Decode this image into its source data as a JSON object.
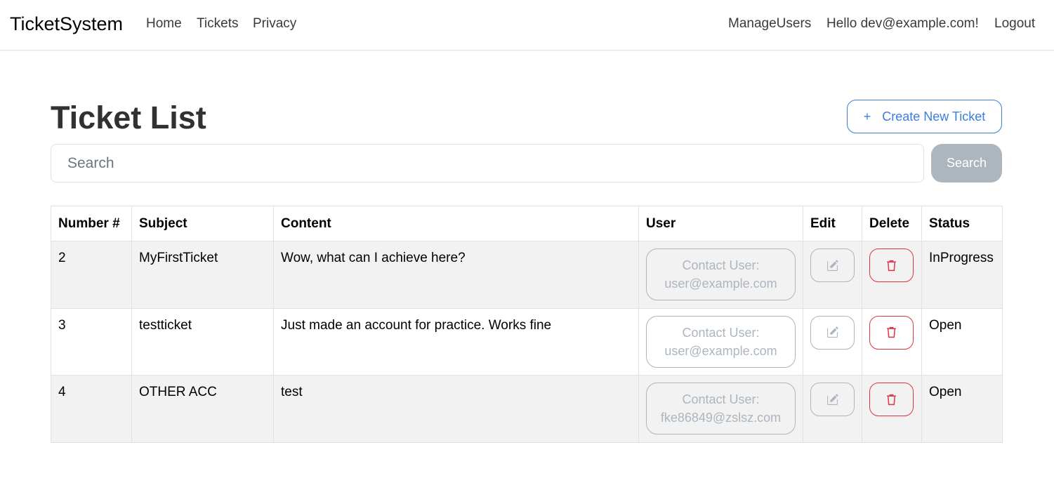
{
  "navbar": {
    "brand": "TicketSystem",
    "links": [
      "Home",
      "Tickets",
      "Privacy"
    ],
    "manage_users": "ManageUsers",
    "greeting": "Hello dev@example.com!",
    "logout": "Logout"
  },
  "header": {
    "title": "Ticket List",
    "create_icon": "plus-icon",
    "create_label": "Create New Ticket"
  },
  "search": {
    "placeholder": "Search",
    "value": "",
    "button_label": "Search"
  },
  "table": {
    "columns": [
      "Number #",
      "Subject",
      "Content",
      "User",
      "Edit",
      "Delete",
      "Status"
    ],
    "rows": [
      {
        "number": "2",
        "subject": "MyFirstTicket",
        "content": "Wow, what can I achieve here?",
        "contact_label": "Contact User:",
        "contact_email": "user@example.com",
        "status": "InProgress"
      },
      {
        "number": "3",
        "subject": "testticket",
        "content": "Just made an account for practice. Works fine",
        "contact_label": "Contact User:",
        "contact_email": "user@example.com",
        "status": "Open"
      },
      {
        "number": "4",
        "subject": "OTHER ACC",
        "content": "test",
        "contact_label": "Contact User:",
        "contact_email": "fke86849@zslsz.com",
        "status": "Open"
      }
    ],
    "edit_icon": "pencil-square-icon",
    "delete_icon": "trash-icon"
  },
  "colors": {
    "primary": "#3b7ddd",
    "secondary": "#adb5bd",
    "danger": "#dc3545",
    "stripe": "#f2f2f2"
  }
}
